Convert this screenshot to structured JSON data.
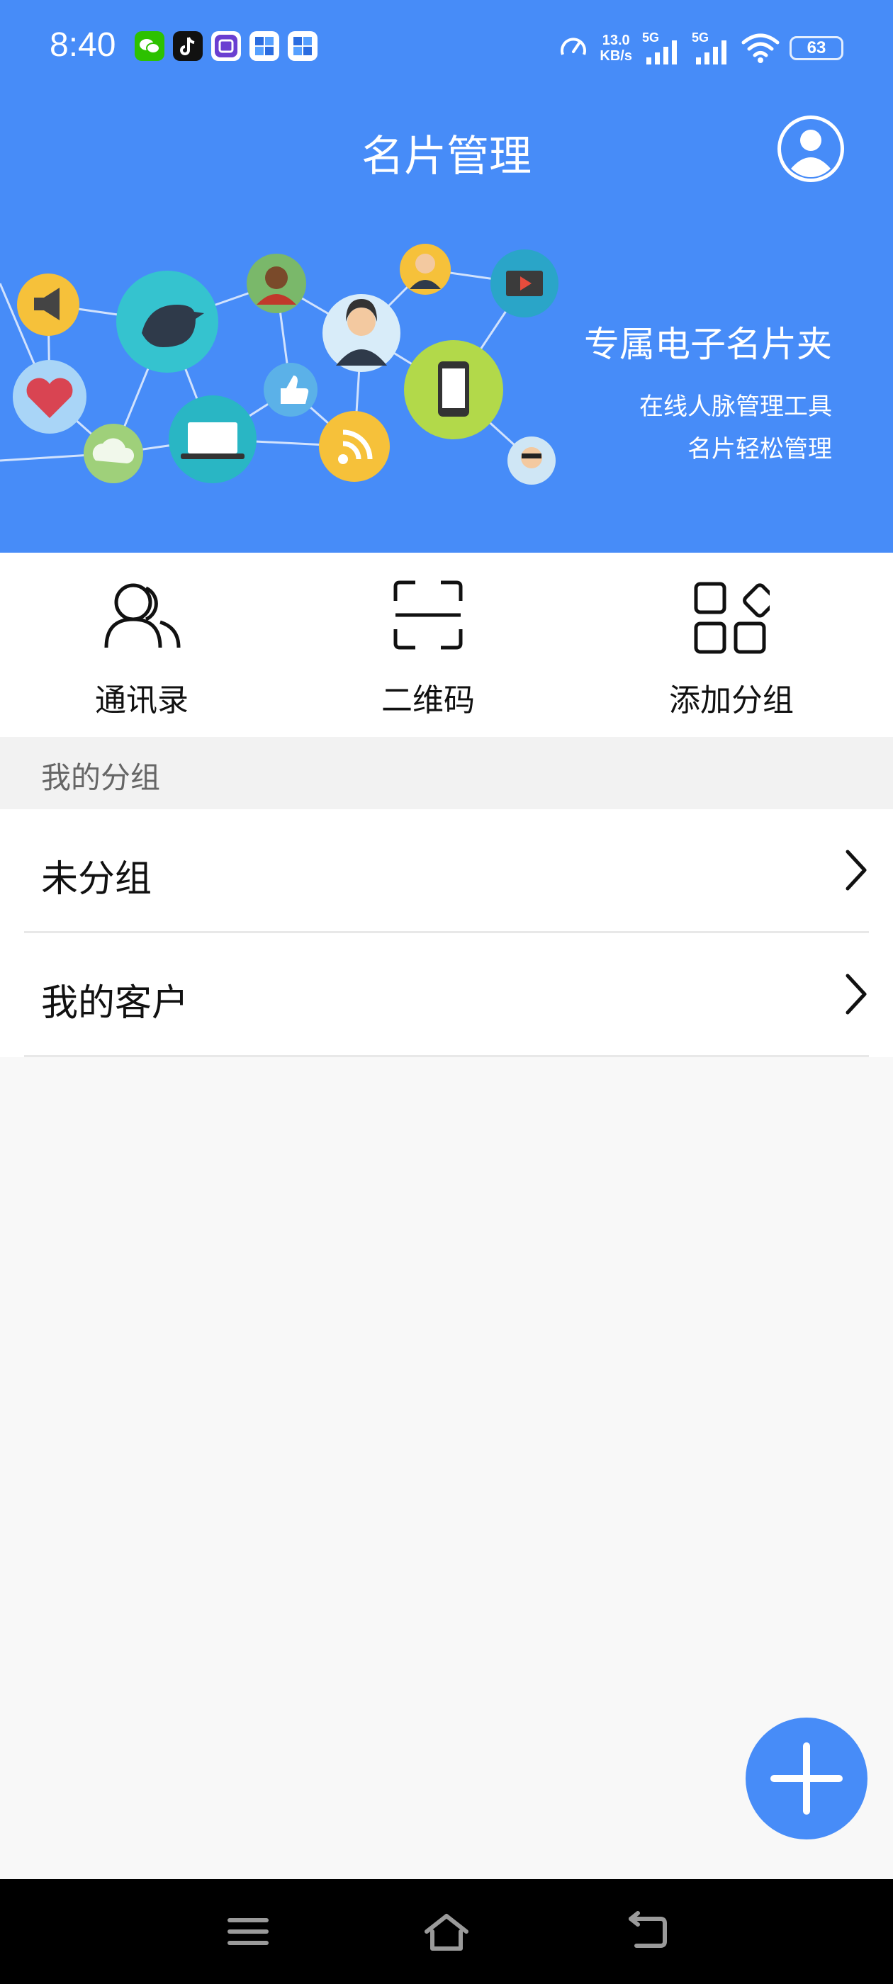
{
  "status_bar": {
    "time": "8:40",
    "net_speed_value": "13.0",
    "net_speed_unit": "KB/s",
    "signal1_label": "5G",
    "signal2_label": "5G",
    "battery": "63",
    "notification_icons": [
      "wechat-icon",
      "tiktok-icon",
      "tie-icon",
      "app-icon",
      "app-icon"
    ]
  },
  "header": {
    "title": "名片管理"
  },
  "banner": {
    "slogan": "专属电子名片夹",
    "subtitle1": "在线人脉管理工具",
    "subtitle2": "名片轻松管理"
  },
  "shortcuts": [
    {
      "label": "通讯录",
      "icon": "contacts-icon"
    },
    {
      "label": "二维码",
      "icon": "qr-scan-icon"
    },
    {
      "label": "添加分组",
      "icon": "add-group-icon"
    }
  ],
  "groups_section": {
    "title": "我的分组",
    "items": [
      {
        "label": "未分组"
      },
      {
        "label": "我的客户"
      }
    ]
  },
  "colors": {
    "primary": "#478cf8",
    "background": "#f8f8f8"
  }
}
